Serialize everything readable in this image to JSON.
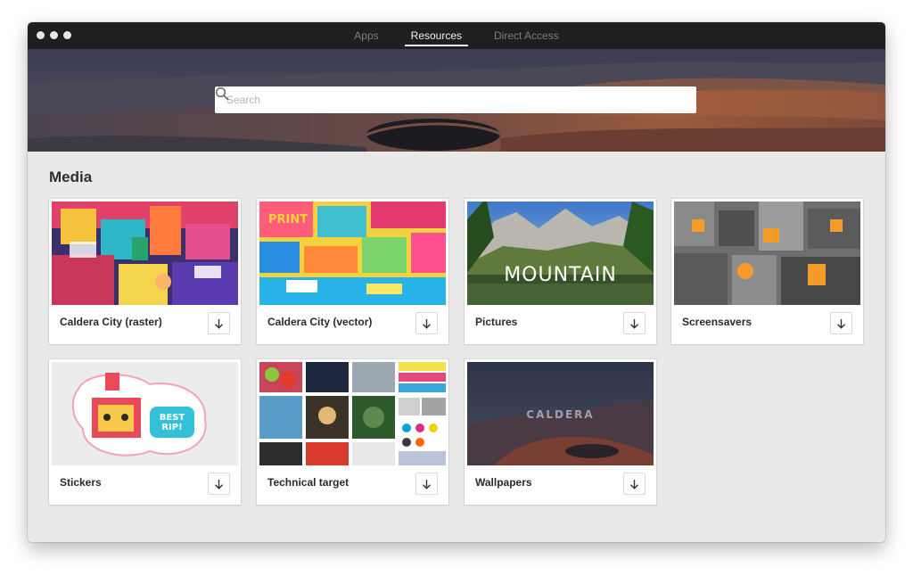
{
  "window": {
    "tabs": [
      {
        "label": "Apps",
        "active": false
      },
      {
        "label": "Resources",
        "active": true
      },
      {
        "label": "Direct Access",
        "active": false
      }
    ]
  },
  "search": {
    "placeholder": "Search",
    "value": "",
    "icon": "search-icon"
  },
  "media": {
    "title": "Media",
    "cards": [
      {
        "label": "Caldera City (raster)",
        "icon": "download-icon"
      },
      {
        "label": "Caldera City (vector)",
        "icon": "download-icon"
      },
      {
        "label": "Pictures",
        "overlay": "MOUNTAIN",
        "icon": "download-icon"
      },
      {
        "label": "Screensavers",
        "icon": "download-icon"
      },
      {
        "label": "Stickers",
        "sticker_text": "BEST RIP!",
        "icon": "download-icon"
      },
      {
        "label": "Technical target",
        "icon": "download-icon"
      },
      {
        "label": "Wallpapers",
        "overlay": "CALDERA",
        "icon": "download-icon"
      }
    ]
  },
  "colors": {
    "titlebar": "#1f1f1f",
    "window_bg": "#e9e9e9",
    "active_tab": "#f2f2f2",
    "inactive_tab": "#7d7d7d"
  }
}
